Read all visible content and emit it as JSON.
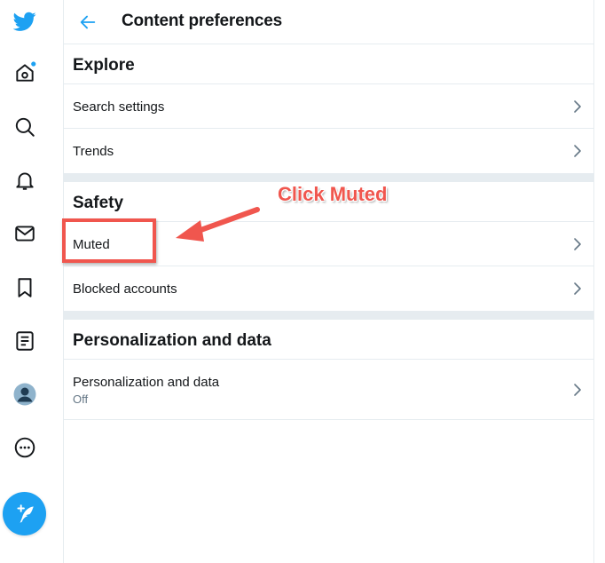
{
  "header": {
    "title": "Content preferences",
    "back_icon": "back-arrow-icon"
  },
  "sidebar": {
    "items": [
      {
        "name": "twitter-logo-icon"
      },
      {
        "name": "home-icon"
      },
      {
        "name": "explore-icon"
      },
      {
        "name": "notifications-icon"
      },
      {
        "name": "messages-icon"
      },
      {
        "name": "bookmarks-icon"
      },
      {
        "name": "lists-icon"
      },
      {
        "name": "profile-avatar"
      },
      {
        "name": "more-icon"
      },
      {
        "name": "compose-tweet-icon"
      }
    ],
    "accent": "#1da1f2"
  },
  "sections": [
    {
      "title": "Explore",
      "rows": [
        {
          "label": "Search settings"
        },
        {
          "label": "Trends"
        }
      ]
    },
    {
      "title": "Safety",
      "rows": [
        {
          "label": "Muted"
        },
        {
          "label": "Blocked accounts"
        }
      ]
    },
    {
      "title": "Personalization and data",
      "rows": [
        {
          "label": "Personalization and data",
          "sub": "Off"
        }
      ]
    }
  ],
  "annotation": {
    "text": "Click Muted",
    "color": "#f0564e"
  }
}
